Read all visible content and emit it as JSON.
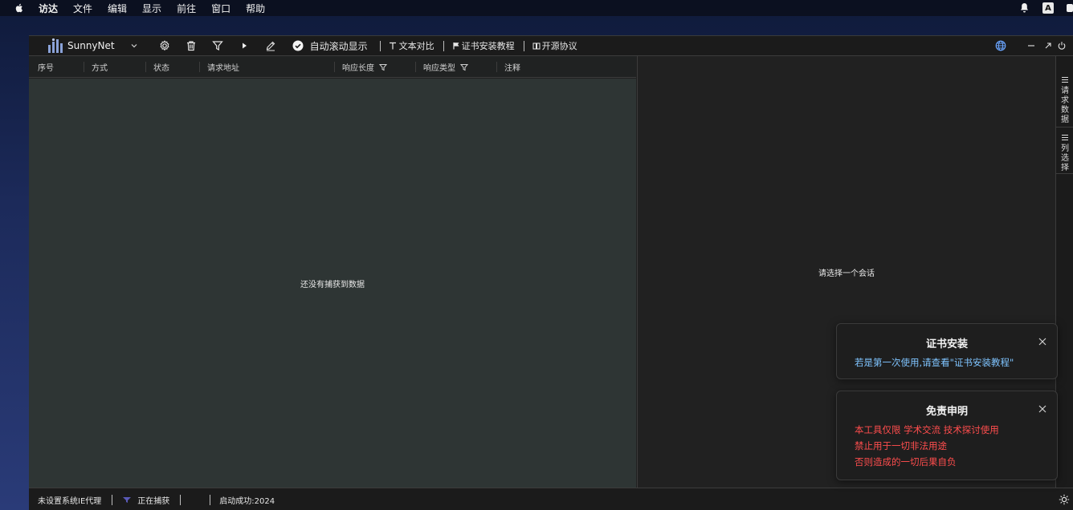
{
  "menubar": {
    "items": [
      "访达",
      "文件",
      "编辑",
      "显示",
      "前往",
      "窗口",
      "帮助"
    ],
    "ime_label": "A"
  },
  "toolbar": {
    "app_name": "SunnyNet",
    "auto_scroll_label": "自动滚动显示",
    "text_compare_label": "文本对比",
    "cert_tutorial_label": "证书安装教程",
    "open_source_label": "开源协议"
  },
  "table": {
    "columns": [
      "序号",
      "方式",
      "状态",
      "请求地址",
      "响应长度",
      "响应类型",
      "注释"
    ],
    "empty_text": "还没有捕获到数据"
  },
  "detail": {
    "empty_text": "请选择一个会话"
  },
  "sidebar": {
    "request_data_chars": [
      "请",
      "求",
      "数",
      "据"
    ],
    "column_select_chars": [
      "列",
      "选",
      "择"
    ]
  },
  "statusbar": {
    "proxy_status": "未设置系统IE代理",
    "capture_status": "正在捕获",
    "start_status": "启动成功:2024"
  },
  "notifications": {
    "cert": {
      "title": "证书安装",
      "message": "若是第一次使用,请查看\"证书安装教程\""
    },
    "disclaimer": {
      "title": "免责申明",
      "lines": [
        "本工具仅限 学术交流 技术探讨使用",
        "禁止用于一切非法用途",
        "否则造成的一切后果自负"
      ]
    }
  },
  "colors": {
    "list_bg": "#2e3534",
    "detail_bg": "#212121",
    "cert_msg": "#7fc4ff",
    "disclaimer_text": "#ff4d4d",
    "logo": "#8aa2d8"
  }
}
